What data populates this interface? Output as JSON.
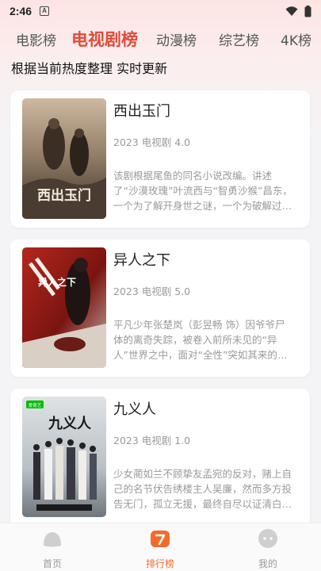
{
  "status": {
    "time": "2:46",
    "a_badge": "A"
  },
  "tabs": [
    {
      "label": "电影榜",
      "active": false
    },
    {
      "label": "电视剧榜",
      "active": true
    },
    {
      "label": "动漫榜",
      "active": false
    },
    {
      "label": "综艺榜",
      "active": false
    },
    {
      "label": "4K榜",
      "active": false
    }
  ],
  "subtitle": "根据当前热度整理 实时更新",
  "cards": [
    {
      "title": "西出玉门",
      "meta": "2023 电视剧 4.0",
      "desc": "该剧根据尾鱼的同名小说改编。讲述了“沙漠玫瑰”叶流西与“智勇沙猴”昌东，一个为了解开身世之谜，一个为破解过往真相，两人联手深入奇…",
      "poster_text": "西出玉门"
    },
    {
      "title": "异人之下",
      "meta": "2023 电视剧 5.0",
      "desc": "平凡少年张楚岚（彭昱畅 饰）因爷爷尸体的离奇失踪，被卷入前所未见的“异人”世界之中，面对“全性”突如其来的追杀、神秘少女冯宝宝（王影璐 饰…",
      "poster_text": "异人之下"
    },
    {
      "title": "九义人",
      "meta": "2023 电视剧 1.0",
      "desc": "少女蔺如兰不顾挚友孟宛的反对，赌上自己的名节伏告绣楼主人吴廉，然而多方投告无门，孤立无援，最终自尽以证清白。孟宛卧薪尝胆七年，攒聚与如…",
      "poster_text": "九义人",
      "poster_badge": "爱奇艺"
    }
  ],
  "nav": [
    {
      "label": "首页",
      "active": false
    },
    {
      "label": "排行榜",
      "active": true
    },
    {
      "label": "我的",
      "active": false
    }
  ],
  "colors": {
    "accent": "#e24b3a",
    "nav_active": "#f36a2c"
  }
}
